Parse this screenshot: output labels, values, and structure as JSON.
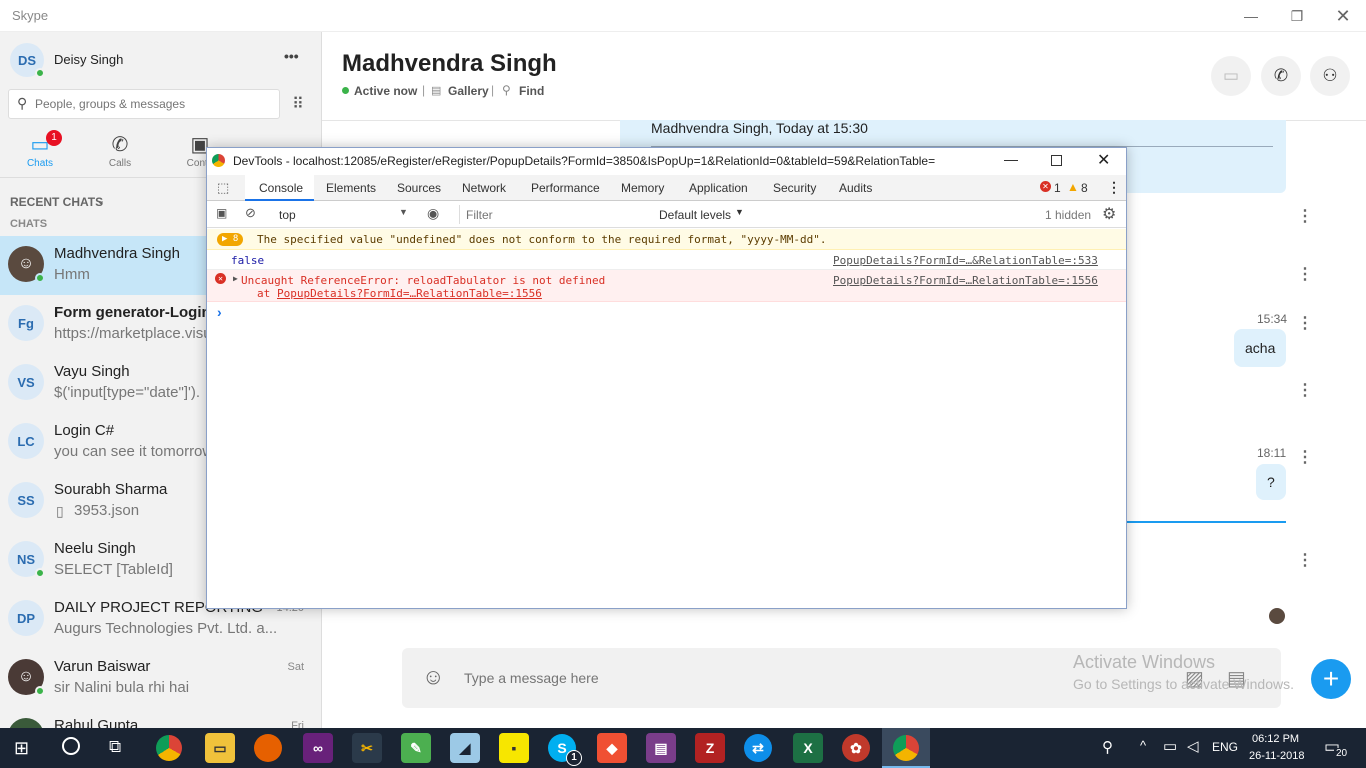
{
  "app": {
    "title": "Skype"
  },
  "profile": {
    "initials": "DS",
    "name": "Deisy Singh",
    "more_label": "•••"
  },
  "search": {
    "placeholder": "People, groups & messages"
  },
  "nav": {
    "chats_label": "Chats",
    "chats_badge": "1",
    "calls_label": "Calls",
    "contacts_label": "Conta"
  },
  "recent": {
    "header": "RECENT CHATS",
    "section": "CHATS"
  },
  "chats": [
    {
      "initials": "",
      "name": "Madhvendra Singh",
      "msg": "Hmm",
      "time": "",
      "online": true
    },
    {
      "initials": "Fg",
      "name": "Form generator-Login",
      "msg": "https://marketplace.visu",
      "time": "",
      "online": false
    },
    {
      "initials": "VS",
      "name": "Vayu Singh",
      "msg": "$('input[type=\"date\"]').",
      "time": "",
      "online": false
    },
    {
      "initials": "LC",
      "name": "Login C#",
      "msg": "you can see it tomorrow",
      "time": "",
      "online": false
    },
    {
      "initials": "SS",
      "name": "Sourabh Sharma",
      "msg": "3953.json",
      "time": "",
      "online": false
    },
    {
      "initials": "NS",
      "name": "Neelu Singh",
      "msg": "SELECT [TableId]",
      "time": "",
      "online": true
    },
    {
      "initials": "DP",
      "name": "DAILY PROJECT REPORTING",
      "msg": "Augurs Technologies Pvt. Ltd. a...",
      "time": "14:20",
      "online": false
    },
    {
      "initials": "",
      "name": "Varun Baiswar",
      "msg": "sir Nalini bula rhi hai",
      "time": "Sat",
      "online": true
    },
    {
      "initials": "",
      "name": "Rahul Gupta",
      "msg": "",
      "time": "Fri",
      "online": false
    }
  ],
  "conversation": {
    "name": "Madhvendra Singh",
    "status": "Active now",
    "gallery": "Gallery",
    "find": "Find",
    "quoted_header": "Madhvendra Singh, Today at 15:30",
    "msg1_time": "15:34",
    "msg1_text": "acha",
    "msg2_time": "18:11",
    "msg2_text": "?"
  },
  "composer": {
    "placeholder": "Type a message here"
  },
  "watermark": {
    "line1": "Activate Windows",
    "line2": "Go to Settings to activate Windows."
  },
  "devtools": {
    "title": "DevTools - localhost:12085/eRegister/eRegister/PopupDetails?FormId=3850&IsPopUp=1&RelationId=0&tableId=59&RelationTable=",
    "tabs": [
      "Console",
      "Elements",
      "Sources",
      "Network",
      "Performance",
      "Memory",
      "Application",
      "Security",
      "Audits"
    ],
    "active_tab": "Console",
    "error_count": "1",
    "warning_count": "8",
    "context": "top",
    "filter_placeholder": "Filter",
    "levels": "Default levels",
    "hidden": "1 hidden",
    "warn_badge": "8",
    "warn_text": "The specified value \"undefined\" does not conform to the required format, \"yyyy-MM-dd\".",
    "log_text": "false",
    "log_src": "PopupDetails?FormId=…&RelationTable=:533",
    "err_text": "Uncaught ReferenceError: reloadTabulator is not defined",
    "err_at": "at",
    "err_at_link": "PopupDetails?FormId=…RelationTable=:1556",
    "err_src": "PopupDetails?FormId=…RelationTable=:1556",
    "prompt": "›"
  },
  "taskbar": {
    "time": "06:12 PM",
    "date": "26-11-2018",
    "lang": "ENG",
    "notif": "20",
    "skype_badge": "1"
  },
  "colors": {
    "accent": "#1a9bf0",
    "bubble": "#dff1fc",
    "taskbar": "#1a2433",
    "online": "#3bb34a",
    "error": "#d93025",
    "warn_bg": "#fffbe5"
  }
}
